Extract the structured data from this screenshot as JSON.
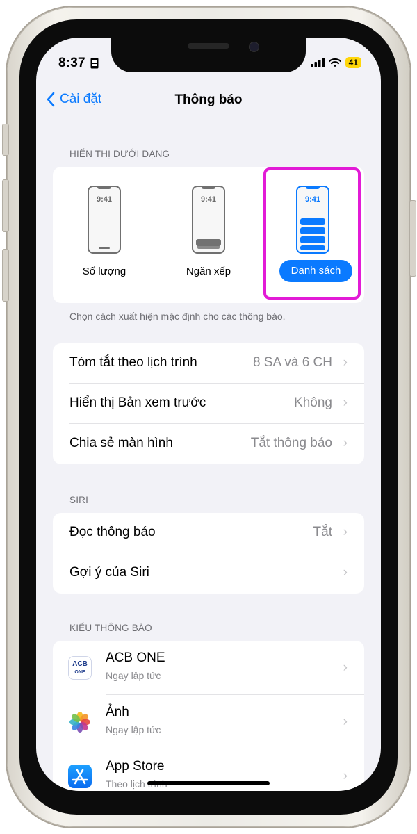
{
  "status_bar": {
    "time": "8:37",
    "battery": "41"
  },
  "nav": {
    "back_label": "Cài đặt",
    "title": "Thông báo"
  },
  "display_as": {
    "header": "HIỂN THỊ DƯỚI DẠNG",
    "options": [
      {
        "label": "Số lượng",
        "time": "9:41"
      },
      {
        "label": "Ngăn xếp",
        "time": "9:41"
      },
      {
        "label": "Danh sách",
        "time": "9:41",
        "selected": true
      }
    ],
    "footnote": "Chọn cách xuất hiện mặc định cho các thông báo."
  },
  "settings": [
    {
      "label": "Tóm tắt theo lịch trình",
      "value": "8 SA và 6 CH"
    },
    {
      "label": "Hiển thị Bản xem trước",
      "value": "Không"
    },
    {
      "label": "Chia sẻ màn hình",
      "value": "Tắt thông báo"
    }
  ],
  "siri": {
    "header": "SIRI",
    "rows": [
      {
        "label": "Đọc thông báo",
        "value": "Tắt"
      },
      {
        "label": "Gợi ý của Siri",
        "value": ""
      }
    ]
  },
  "notification_style": {
    "header": "KIỂU THÔNG BÁO",
    "apps": [
      {
        "name": "ACB ONE",
        "sub": "Ngay lập tức",
        "icon": "acb-one-icon",
        "icon_text": "ACB",
        "icon_text2": "ONE"
      },
      {
        "name": "Ảnh",
        "sub": "Ngay lập tức",
        "icon": "photos-icon"
      },
      {
        "name": "App Store",
        "sub": "Theo lịch trình",
        "icon": "app-store-icon"
      }
    ]
  },
  "colors": {
    "accent": "#0a7aff",
    "highlight": "#e21bd6",
    "background": "#f2f2f7"
  }
}
